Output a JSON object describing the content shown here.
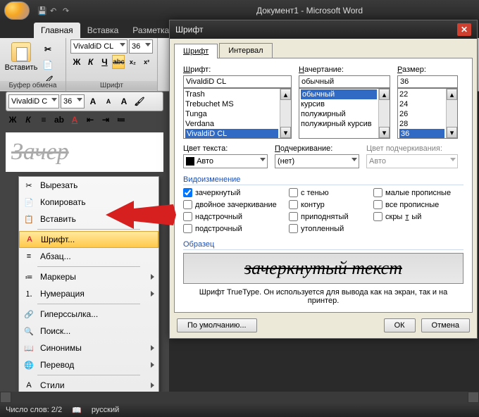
{
  "titlebar": {
    "doc_title": "Документ1 - Microsoft Word"
  },
  "ribbon_tabs": {
    "home": "Главная",
    "insert": "Вставка",
    "layout": "Разметка ст"
  },
  "ribbon": {
    "paste": "Вставить",
    "clipboard_label": "Буфер обмена",
    "font_label": "Шрифт",
    "font_name": "VivaldiD CL",
    "font_size": "36",
    "btn_bold": "Ж",
    "btn_italic": "К",
    "btn_under": "Ч",
    "btn_strike": "abc"
  },
  "mini_toolbar": {
    "font_name": "VivaldiD C",
    "font_size": "36"
  },
  "doc_sample": "Зачер",
  "context_menu": {
    "cut": "Вырезать",
    "copy": "Копировать",
    "paste": "Вставить",
    "font": "Шрифт...",
    "paragraph": "Абзац...",
    "bullets": "Маркеры",
    "numbering": "Нумерация",
    "hyperlink": "Гиперссылка...",
    "lookup": "Поиск...",
    "synonyms": "Синонимы",
    "translate": "Перевод",
    "styles": "Стили"
  },
  "dialog": {
    "title": "Шрифт",
    "tab_font": "Шрифт",
    "tab_spacing": "Интервал",
    "lbl_font": "Шрифт:",
    "lbl_style": "Начертание:",
    "lbl_size": "Размер:",
    "font_value": "VivaldiD CL",
    "style_value": "обычный",
    "size_value": "36",
    "font_list": [
      "Trash",
      "Trebuchet MS",
      "Tunga",
      "Verdana",
      "VivaldiD CL"
    ],
    "style_list": [
      "обычный",
      "курсив",
      "полужирный",
      "полужирный курсив"
    ],
    "size_list": [
      "22",
      "24",
      "26",
      "28",
      "36"
    ],
    "lbl_color": "Цвет текста:",
    "color_value": "Авто",
    "lbl_underline": "Подчеркивание:",
    "underline_value": "(нет)",
    "lbl_ucolor": "Цвет подчеркивания:",
    "ucolor_value": "Авто",
    "sect_effects": "Видоизменение",
    "chk_strike": "зачеркнутый",
    "chk_dstrike": "двойное зачеркивание",
    "chk_super": "надстрочный",
    "chk_sub": "подстрочный",
    "chk_shadow": "с тенью",
    "chk_outline": "контур",
    "chk_emboss": "приподнятый",
    "chk_engrave": "утопленный",
    "chk_smallcaps": "малые прописные",
    "chk_allcaps": "все прописные",
    "chk_hidden": "скрытый",
    "sect_sample": "Образец",
    "sample_text": "зачеркнутый текст",
    "sample_note": "Шрифт TrueType. Он используется для вывода как на экран, так и на принтер.",
    "btn_default": "По умолчанию...",
    "btn_ok": "ОК",
    "btn_cancel": "Отмена"
  },
  "status": {
    "words": "Число слов: 2/2",
    "lang": "русский"
  }
}
